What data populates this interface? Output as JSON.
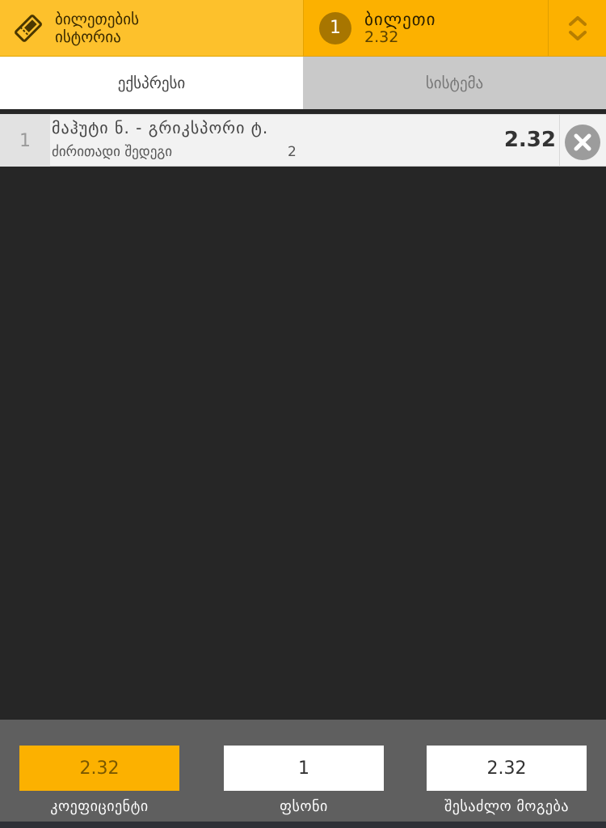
{
  "header": {
    "history_label_line1": "ბილეთების",
    "history_label_line2": "ისტორია",
    "ticket_count": "1",
    "ticket_label": "ბილეთი",
    "ticket_odds": "2.32"
  },
  "tabs": [
    {
      "label": "ექსპრესი",
      "active": true
    },
    {
      "label": "სისტემა",
      "active": false
    }
  ],
  "bets": [
    {
      "index": "1",
      "match": "მაჰუტი ნ. - გრიკსპორი ტ.",
      "market": "ძირითადი შედეგი",
      "outcome": "2",
      "odds": "2.32"
    }
  ],
  "footer": {
    "odds_value": "2.32",
    "odds_label": "კოეფიციენტი",
    "stake_value": "1",
    "stake_label": "ფსონი",
    "win_value": "2.32",
    "win_label": "შესაძლო მოგება"
  },
  "colors": {
    "accent": "#fcb100",
    "accent_light": "#fdc12c",
    "background": "#262626",
    "footer": "#5f5f5f"
  },
  "icons": {
    "history": "ticket-icon",
    "toggle": "chevron-up-down-icon",
    "remove": "close-circle-icon"
  }
}
